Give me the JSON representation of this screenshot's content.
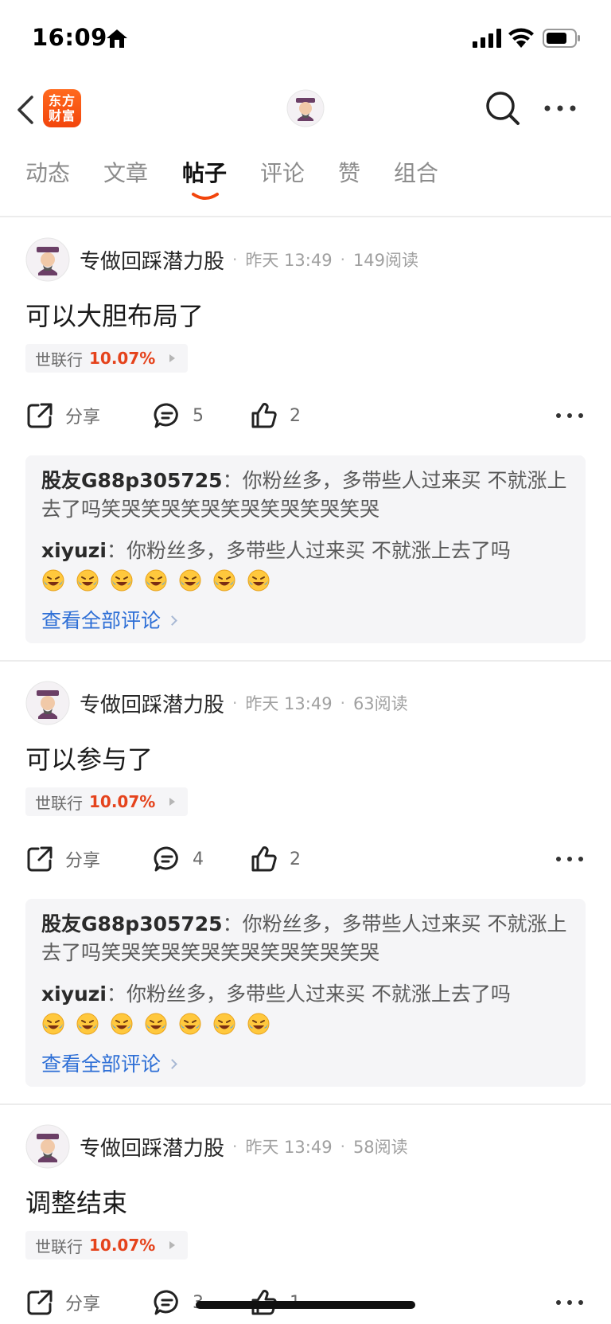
{
  "status_bar": {
    "time": "16:09"
  },
  "nav": {
    "logo_line1": "东方",
    "logo_line2": "财富"
  },
  "tabs": [
    {
      "label": "动态",
      "active": false
    },
    {
      "label": "文章",
      "active": false
    },
    {
      "label": "帖子",
      "active": true
    },
    {
      "label": "评论",
      "active": false
    },
    {
      "label": "赞",
      "active": false
    },
    {
      "label": "组合",
      "active": false
    }
  ],
  "colors": {
    "accent_orange": "#f2450c",
    "stock_up": "#e5431c",
    "link_blue": "#2e6fd6"
  },
  "posts": [
    {
      "author": "专做回踩潜力股",
      "time": "昨天 13:49",
      "reads": "149阅读",
      "title": "可以大胆布局了",
      "stock_name": "世联行",
      "stock_change": "10.07%",
      "share_label": "分享",
      "comment_count": "5",
      "like_count": "2",
      "comments": [
        {
          "author": "股友G88p305725",
          "sep": "：",
          "text": "你粉丝多，多带些人过来买 不就涨上去了吗笑哭笑哭笑哭笑哭笑哭笑哭笑哭"
        },
        {
          "author": "xiyuzi",
          "sep": "：",
          "text": "你粉丝多，多带些人过来买 不就涨上去了吗",
          "emoji": "tears-of-joy-icon",
          "emoji_count": 7
        }
      ],
      "view_all_label": "查看全部评论"
    },
    {
      "author": "专做回踩潜力股",
      "time": "昨天 13:49",
      "reads": "63阅读",
      "title": "可以参与了",
      "stock_name": "世联行",
      "stock_change": "10.07%",
      "share_label": "分享",
      "comment_count": "4",
      "like_count": "2",
      "comments": [
        {
          "author": "股友G88p305725",
          "sep": "：",
          "text": "你粉丝多，多带些人过来买 不就涨上去了吗笑哭笑哭笑哭笑哭笑哭笑哭笑哭"
        },
        {
          "author": "xiyuzi",
          "sep": "：",
          "text": "你粉丝多，多带些人过来买 不就涨上去了吗",
          "emoji": "tears-of-joy-icon",
          "emoji_count": 7
        }
      ],
      "view_all_label": "查看全部评论"
    },
    {
      "author": "专做回踩潜力股",
      "time": "昨天 13:49",
      "reads": "58阅读",
      "title": "调整结束",
      "stock_name": "世联行",
      "stock_change": "10.07%",
      "share_label": "分享",
      "comment_count": "3",
      "like_count": "1"
    }
  ]
}
